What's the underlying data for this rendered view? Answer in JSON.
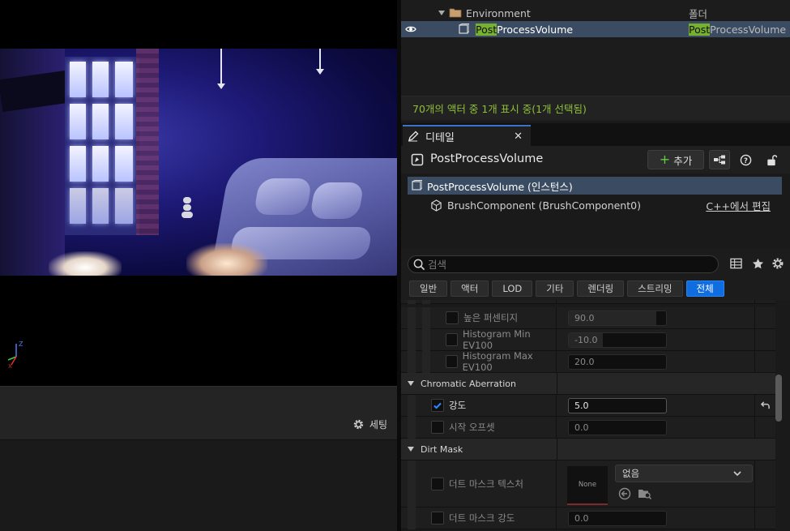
{
  "viewport": {
    "settings_label": "세팅"
  },
  "outliner": {
    "rows": [
      {
        "name": "Environment",
        "type": "폴더"
      },
      {
        "name_highlight": "Post",
        "name_rest": "ProcessVolume",
        "type_highlight": "Post",
        "type_rest": "ProcessVolume"
      }
    ],
    "status": "70개의 액터 중 1개 표시 중(1개 선택됨)"
  },
  "details": {
    "tab_label": "디테일",
    "actor_title": "PostProcessVolume",
    "add_label": "추가",
    "components": [
      {
        "label": "PostProcessVolume (인스턴스)"
      },
      {
        "label": "BrushComponent (BrushComponent0)"
      }
    ],
    "edit_cpp_label": "C++에서 편집",
    "search_placeholder": "검색",
    "filters": [
      "일반",
      "액터",
      "LOD",
      "기타",
      "렌더링",
      "스트리밍",
      "전체"
    ],
    "active_filter": "전체",
    "properties": {
      "high_percent": {
        "label": "높은 퍼센티지",
        "value": "90.0"
      },
      "hist_min": {
        "label": "Histogram Min EV100",
        "value": "-10.0"
      },
      "hist_max": {
        "label": "Histogram Max EV100",
        "value": "20.0"
      },
      "chromatic_category": "Chromatic Aberration",
      "intensity": {
        "label": "강도",
        "value": "5.0",
        "checked": true
      },
      "start_offset": {
        "label": "시작 오프셋",
        "value": "0.0"
      },
      "dirt_category": "Dirt Mask",
      "dirt_texture": {
        "label": "더트 마스크 텍스처",
        "preview": "None",
        "dropdown": "없음"
      },
      "dirt_intensity": {
        "label": "더트 마스크 강도",
        "value": "0.0"
      }
    }
  },
  "colors": {
    "accent_blue": "#0f6de0",
    "selection": "#3b4c62",
    "highlight_green": "#76b12f",
    "status_green": "#8fbf38"
  }
}
